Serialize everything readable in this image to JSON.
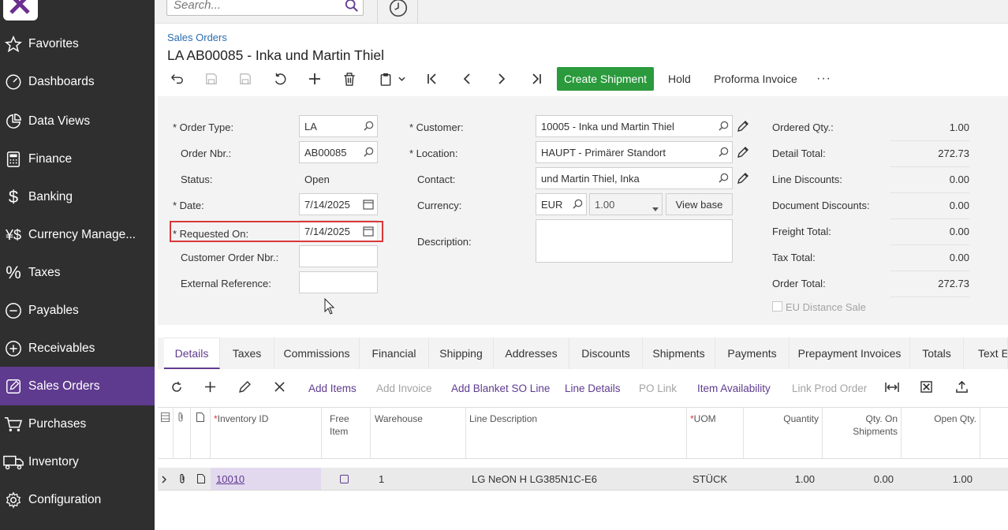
{
  "sidebar": {
    "items": [
      {
        "label": "Favorites",
        "icon": "star-icon"
      },
      {
        "label": "Dashboards",
        "icon": "gauge-icon"
      },
      {
        "label": "Data Views",
        "icon": "pie-icon"
      },
      {
        "label": "Finance",
        "icon": "calculator-icon"
      },
      {
        "label": "Banking",
        "icon": "dollar-icon"
      },
      {
        "label": "Currency Manage...",
        "icon": "currency-icon"
      },
      {
        "label": "Taxes",
        "icon": "percent-icon"
      },
      {
        "label": "Payables",
        "icon": "minus-circle-icon"
      },
      {
        "label": "Receivables",
        "icon": "plus-circle-icon"
      },
      {
        "label": "Sales Orders",
        "icon": "edit-icon"
      },
      {
        "label": "Purchases",
        "icon": "cart-icon"
      },
      {
        "label": "Inventory",
        "icon": "truck-icon"
      },
      {
        "label": "Configuration",
        "icon": "gear-icon"
      }
    ]
  },
  "search": {
    "placeholder": "Search..."
  },
  "breadcrumb": "Sales Orders",
  "title": "LA AB00085 - Inka und Martin Thiel",
  "toolbar": {
    "create_shipment": "Create Shipment",
    "hold": "Hold",
    "proforma": "Proforma Invoice",
    "more": "···"
  },
  "form": {
    "order_type_label": "Order Type:",
    "order_type": "LA",
    "order_nbr_label": "Order Nbr.:",
    "order_nbr": "AB00085",
    "status_label": "Status:",
    "status": "Open",
    "date_label": "Date:",
    "date": "7/14/2025",
    "requested_on_label": "Requested On:",
    "requested_on": "7/14/2025",
    "customer_order_label": "Customer Order Nbr.:",
    "external_ref_label": "External Reference:",
    "customer_label": "Customer:",
    "customer": "10005 - Inka und Martin Thiel",
    "location_label": "Location:",
    "location": "HAUPT - Primärer Standort",
    "contact_label": "Contact:",
    "contact": "und Martin Thiel, Inka",
    "currency_label": "Currency:",
    "currency": "EUR",
    "rate": "1.00",
    "view_base": "View base",
    "description_label": "Description:"
  },
  "totals": {
    "ordered_qty_label": "Ordered Qty.:",
    "ordered_qty": "1.00",
    "detail_total_label": "Detail Total:",
    "detail_total": "272.73",
    "line_discounts_label": "Line Discounts:",
    "line_discounts": "0.00",
    "document_discounts_label": "Document Discounts:",
    "document_discounts": "0.00",
    "freight_total_label": "Freight Total:",
    "freight_total": "0.00",
    "tax_total_label": "Tax Total:",
    "tax_total": "0.00",
    "order_total_label": "Order Total:",
    "order_total": "272.73",
    "eu_distance_label": "EU Distance Sale"
  },
  "tabs": [
    "Details",
    "Taxes",
    "Commissions",
    "Financial",
    "Shipping",
    "Addresses",
    "Discounts",
    "Shipments",
    "Payments",
    "Prepayment Invoices",
    "Totals",
    "Text El"
  ],
  "grid_toolbar": {
    "add_items": "Add Items",
    "add_invoice": "Add Invoice",
    "add_blanket": "Add Blanket SO Line",
    "line_details": "Line Details",
    "po_link": "PO Link",
    "item_availability": "Item Availability",
    "link_prod_order": "Link Prod Order"
  },
  "grid": {
    "headers": {
      "inventory_id": "Inventory ID",
      "free_item_1": "Free",
      "free_item_2": "Item",
      "warehouse": "Warehouse",
      "line_description": "Line Description",
      "uom": "UOM",
      "quantity": "Quantity",
      "qty_on_ship_1": "Qty. On",
      "qty_on_ship_2": "Shipments",
      "open_qty": "Open Qty."
    },
    "rows": [
      {
        "inventory_id": "10010",
        "warehouse": "1",
        "description": "LG NeON H LG385N1C-E6",
        "uom": "STÜCK",
        "quantity": "1.00",
        "qty_on_shipments": "0.00",
        "open_qty": "1.00"
      }
    ]
  },
  "colors": {
    "accent": "#5f3b8f",
    "green": "#2a9a3c",
    "highlight": "#d9383a"
  }
}
